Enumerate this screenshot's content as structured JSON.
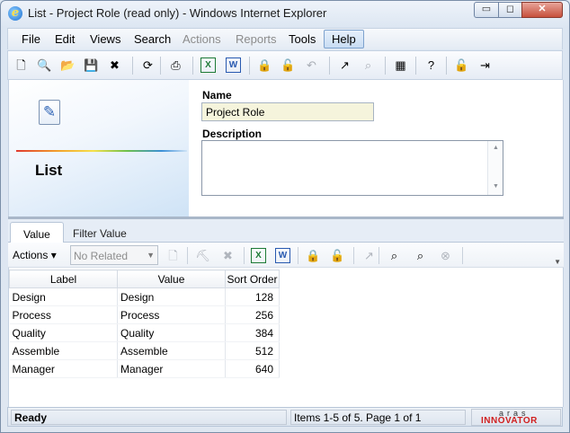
{
  "window": {
    "title": "List - Project Role (read only) - Windows Internet Explorer",
    "ie_icon": "e",
    "min_glyph": "▭",
    "max_glyph": "◻",
    "close_glyph": "✕"
  },
  "menu": {
    "file": "File",
    "edit": "Edit",
    "views": "Views",
    "search": "Search",
    "actions": "Actions",
    "reports": "Reports",
    "tools": "Tools",
    "help": "Help"
  },
  "toolbar_icons": [
    {
      "name": "new-icon",
      "glyph": "🗋",
      "enabled": true
    },
    {
      "name": "view-icon",
      "glyph": "🔍",
      "enabled": false
    },
    {
      "name": "open-icon",
      "glyph": "📂",
      "enabled": false
    },
    {
      "name": "save-icon",
      "glyph": "💾",
      "enabled": false
    },
    {
      "name": "delete-icon",
      "glyph": "✖",
      "enabled": true
    },
    {
      "name": "refresh-icon",
      "glyph": "⟳",
      "enabled": true
    },
    {
      "name": "print-icon",
      "glyph": "⎙",
      "enabled": true
    },
    {
      "name": "excel-icon",
      "glyph": "X",
      "enabled": true
    },
    {
      "name": "word-icon",
      "glyph": "W",
      "enabled": true
    },
    {
      "name": "lock-icon",
      "glyph": "🔒",
      "enabled": true
    },
    {
      "name": "unlock-icon",
      "glyph": "🔓",
      "enabled": false
    },
    {
      "name": "undo-icon",
      "glyph": "↶",
      "enabled": false
    },
    {
      "name": "promote-icon",
      "glyph": "↗",
      "enabled": true
    },
    {
      "name": "where-used-icon",
      "glyph": "⌕",
      "enabled": false
    },
    {
      "name": "structure-icon",
      "glyph": "▦",
      "enabled": true
    },
    {
      "name": "help-icon",
      "glyph": "?",
      "enabled": true
    },
    {
      "name": "unclaim-icon",
      "glyph": "🔓",
      "enabled": false
    },
    {
      "name": "exit-icon",
      "glyph": "⇥",
      "enabled": true
    }
  ],
  "form": {
    "title": "List",
    "name_label": "Name",
    "name_value": "Project Role",
    "description_label": "Description",
    "description_value": ""
  },
  "tabs": {
    "value": "Value",
    "filter_value": "Filter Value"
  },
  "grid_toolbar": {
    "actions_label": "Actions",
    "actions_arrow": "▾",
    "related_placeholder": "No Related",
    "related_arrow": "▼"
  },
  "grid": {
    "columns": [
      "Label",
      "Value",
      "Sort Order"
    ],
    "rows": [
      {
        "label": "Design",
        "value": "Design",
        "sort_order": "128"
      },
      {
        "label": "Process",
        "value": "Process",
        "sort_order": "256"
      },
      {
        "label": "Quality",
        "value": "Quality",
        "sort_order": "384"
      },
      {
        "label": "Assemble",
        "value": "Assemble",
        "sort_order": "512"
      },
      {
        "label": "Manager",
        "value": "Manager",
        "sort_order": "640"
      }
    ]
  },
  "status": {
    "state": "Ready",
    "items": "Items 1-5 of 5. Page 1 of 1",
    "brand_top": "aras",
    "brand_bottom": "INNOVATOR"
  }
}
